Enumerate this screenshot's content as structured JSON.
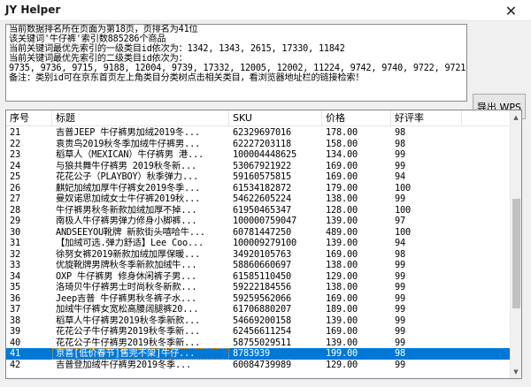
{
  "window": {
    "title": "JY Helper",
    "close_glyph": "✕"
  },
  "info_lines": [
    "当前数据排名所在页面为第18页，页排名为41位",
    "该关键词'牛仔裤'索引数885286个商品",
    "当前关键词最优先索引的一级类目id依次为：1342, 1343, 2615, 17330, 11842",
    "当前关键词最优先索引的二级类目id依次为：",
    "9735, 9736, 9715, 9188, 12004, 9739, 17332, 12005, 12002, 11224, 9742, 9740, 9722, 9721, 9717, 1350",
    "备注：类别id可在京东首页左上角类目分类树点击相关类目，看浏览器地址栏的链接检索！"
  ],
  "export_button": "导出 WPS",
  "table": {
    "columns": [
      "序号",
      "标题",
      "SKU",
      "价格",
      "好评率"
    ],
    "rows": [
      [
        "21",
        "吉普JEEP 牛仔裤男加绒2019冬...",
        "62329697016",
        "178.00",
        "98"
      ],
      [
        "22",
        "袁贵鸟2019秋冬季加绒牛仔裤男...",
        "62227203118",
        "158.00",
        "98"
      ],
      [
        "23",
        "稻草人（MEXICAN）牛仔裤男 港...",
        "100004448625",
        "134.00",
        "99"
      ],
      [
        "24",
        "与狼共舞牛仔裤男 2019秋冬新...",
        "53067921922",
        "169.00",
        "99"
      ],
      [
        "25",
        "花花公子（PLAYBOY）秋季弹力...",
        "59160575815",
        "169.00",
        "94"
      ],
      [
        "26",
        "麒妃加绒加厚牛仔裤女2019冬季...",
        "61534182872",
        "179.00",
        "100"
      ],
      [
        "27",
        "曼奴诺思加绒女士牛仔裤2019秋...",
        "54622605224",
        "138.00",
        "99"
      ],
      [
        "28",
        "牛仔裤男秋冬新款加绒加厚不掉...",
        "61950465347",
        "128.00",
        "100"
      ],
      [
        "29",
        "南极人牛仔裤男弹力修身小脚裤...",
        "100000759047",
        "139.00",
        "97"
      ],
      [
        "30",
        "ANDSEEYOU靴牌 新款街头嘻哈牛...",
        "60781447250",
        "489.00",
        "100"
      ],
      [
        "31",
        "【加绒可选.弹力舒适】Lee Coo...",
        "100009279100",
        "139.00",
        "94"
      ],
      [
        "32",
        "徐努女裤2019新款加绒加厚保暖...",
        "34920105763",
        "169.00",
        "98"
      ],
      [
        "33",
        "优旋靴牌男牌秋冬季新款加绒牛...",
        "58860660697",
        "138.00",
        "99"
      ],
      [
        "34",
        "OXP 牛仔裤男 修身休闲裤子男...",
        "61585110450",
        "129.00",
        "99"
      ],
      [
        "35",
        "洛琦贝牛仔裤男士时尚秋冬新款...",
        "59222184556",
        "138.00",
        "99"
      ],
      [
        "36",
        "Jeep吉普 牛仔裤男秋冬裤子水...",
        "59259562066",
        "169.00",
        "99"
      ],
      [
        "37",
        "加绒牛仔裤女宽松高腰阔腿裤20...",
        "61706880207",
        "189.00",
        "99"
      ],
      [
        "38",
        "稻草人牛仔裤男2019秋冬季新款...",
        "54669200158",
        "139.00",
        "99"
      ],
      [
        "39",
        "花花公子牛仔裤男2019秋冬季新...",
        "62456611254",
        "169.00",
        "99"
      ],
      [
        "40",
        "花花公子牛仔裤男2019秋冬季新...",
        "58755029511",
        "139.00",
        "99"
      ],
      [
        "41",
        "京喜[低价春节]售完不架]牛仔...",
        "8783939",
        "199.00",
        "98"
      ],
      [
        "42",
        "吉普登加绒牛仔裤男2019冬季...",
        "60084739989",
        "129.00",
        "99"
      ]
    ],
    "selected_index": 20
  },
  "colors": {
    "selection": "#0078d7",
    "accent_outline": "#ff9900"
  },
  "icons": {
    "scroll_up": "▲",
    "scroll_down": "▼"
  }
}
